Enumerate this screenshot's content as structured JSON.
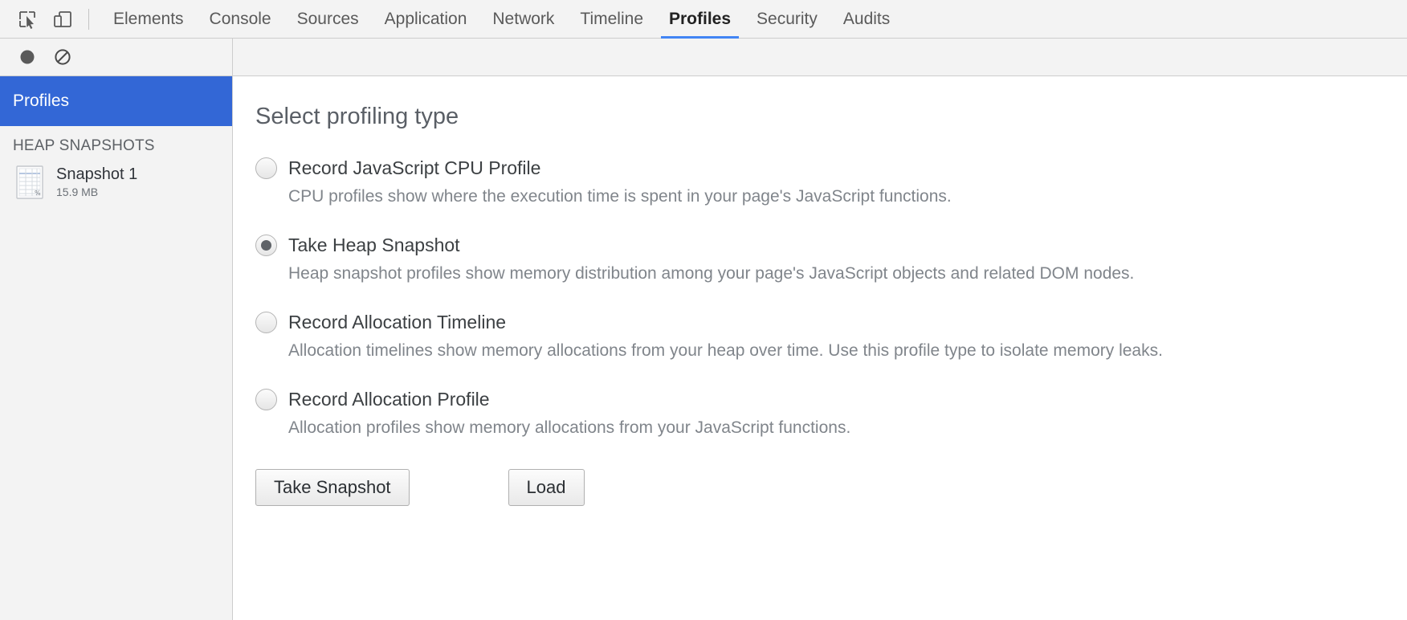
{
  "toolbar": {
    "inspect_icon": "inspect-element-icon",
    "device_icon": "device-toolbar-icon",
    "tabs": [
      {
        "label": "Elements",
        "active": false
      },
      {
        "label": "Console",
        "active": false
      },
      {
        "label": "Sources",
        "active": false
      },
      {
        "label": "Application",
        "active": false
      },
      {
        "label": "Network",
        "active": false
      },
      {
        "label": "Timeline",
        "active": false
      },
      {
        "label": "Profiles",
        "active": true
      },
      {
        "label": "Security",
        "active": false
      },
      {
        "label": "Audits",
        "active": false
      }
    ],
    "active_tab": "Profiles",
    "accent_color": "#4285f4"
  },
  "actionbar": {
    "record_icon": "record-circle-icon",
    "clear_icon": "clear-prohibited-icon"
  },
  "sidebar": {
    "header": "Profiles",
    "header_color": "#3367d6",
    "section_label": "HEAP SNAPSHOTS",
    "snapshots": [
      {
        "icon": "heap-snapshot-grid-icon",
        "title": "Snapshot 1",
        "size": "15.9 MB"
      }
    ]
  },
  "main": {
    "title": "Select profiling type",
    "options": [
      {
        "label": "Record JavaScript CPU Profile",
        "selected": false,
        "description": "CPU profiles show where the execution time is spent in your page's JavaScript functions."
      },
      {
        "label": "Take Heap Snapshot",
        "selected": true,
        "description": "Heap snapshot profiles show memory distribution among your page's JavaScript objects and related DOM nodes."
      },
      {
        "label": "Record Allocation Timeline",
        "selected": false,
        "description": "Allocation timelines show memory allocations from your heap over time. Use this profile type to isolate memory leaks."
      },
      {
        "label": "Record Allocation Profile",
        "selected": false,
        "description": "Allocation profiles show memory allocations from your JavaScript functions."
      }
    ],
    "primary_button": "Take Snapshot",
    "secondary_button": "Load"
  }
}
